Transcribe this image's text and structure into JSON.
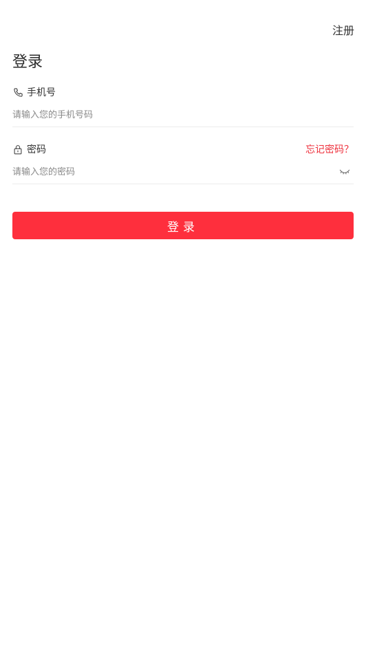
{
  "header": {
    "register_label": "注册",
    "title": "登录"
  },
  "phone_field": {
    "label": "手机号",
    "icon": "phone-icon",
    "placeholder": "请输入您的手机号码",
    "value": ""
  },
  "password_field": {
    "label": "密码",
    "icon": "lock-icon",
    "placeholder": "请输入您的密码",
    "value": "",
    "forgot_label": "忘记密码？",
    "toggle_icon": "eye-closed-icon"
  },
  "login_button": {
    "label": "登录"
  },
  "colors": {
    "accent": "#fe2f3d",
    "forgot": "#ee2f3b",
    "text": "#333333",
    "placeholder": "#8a8a8a",
    "divider": "#ececec"
  }
}
